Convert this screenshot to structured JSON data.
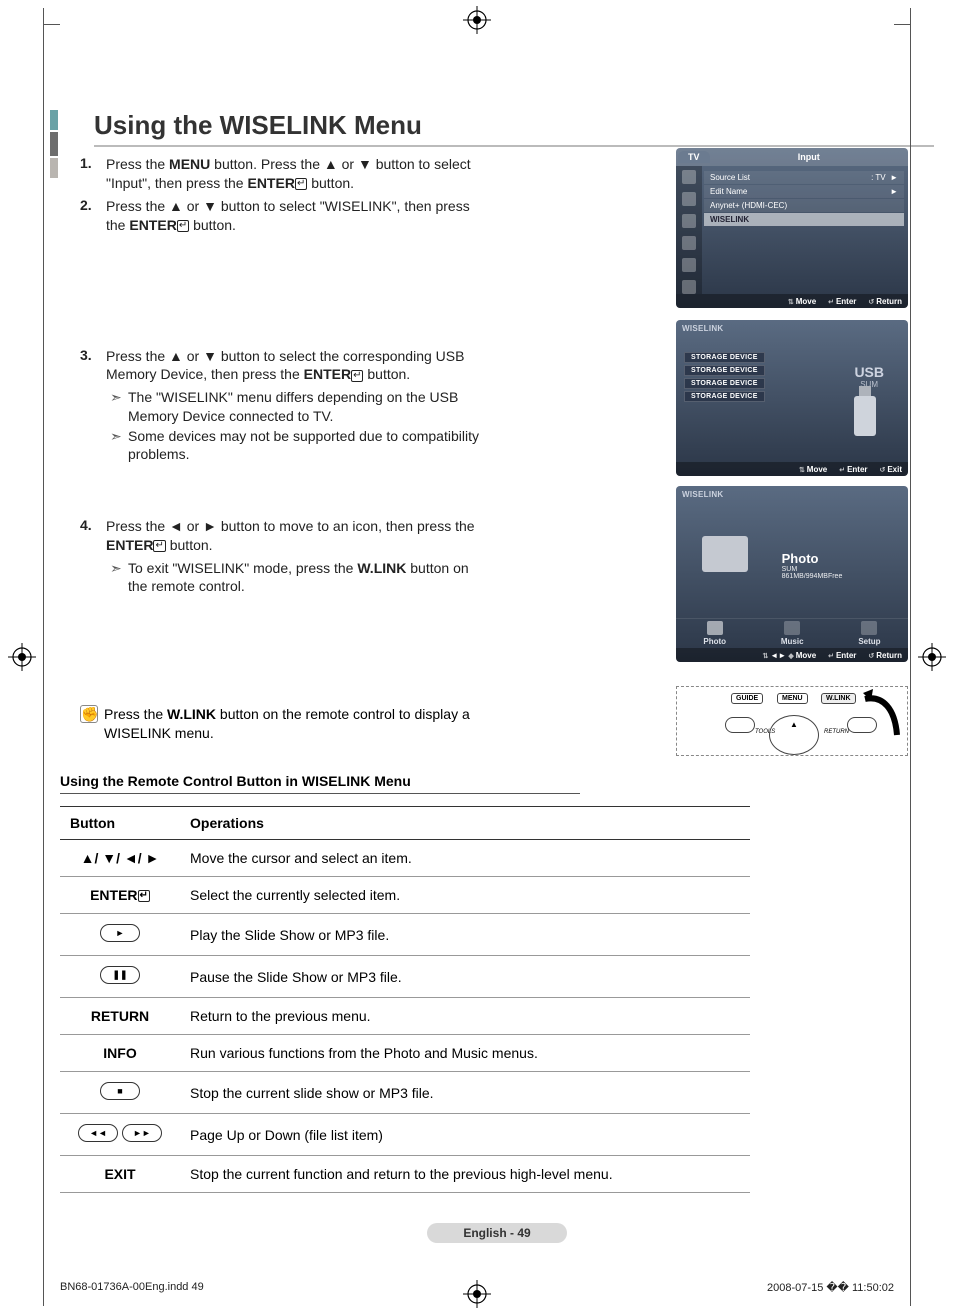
{
  "title": "Using the WISELINK Menu",
  "steps": {
    "s1": {
      "num": "1.",
      "text_a": "Press the ",
      "menu": "MENU",
      "text_b": " button. Press the ▲ or ▼ button to select \"Input\", then press the ",
      "enter": "ENTER",
      "text_c": " button."
    },
    "s2": {
      "num": "2.",
      "text_a": "Press the ▲ or ▼ button to select \"WISELINK\", then press the ",
      "enter": "ENTER",
      "text_b": " button."
    },
    "s3": {
      "num": "3.",
      "text_a": "Press the ▲ or ▼ button to select the corresponding USB Memory Device, then press the ",
      "enter": "ENTER",
      "text_b": " button."
    },
    "s3b1": "The \"WISELINK\" menu differs depending on the USB Memory Device connected to TV.",
    "s3b2": "Some devices may not be supported due to compatibility problems.",
    "s4": {
      "num": "4.",
      "text_a": "Press the ◄ or ► button to move to an icon, then press the ",
      "enter": "ENTER",
      "text_b": " button."
    },
    "s4b1_a": "To exit \"WISELINK\" mode, press the ",
    "s4b1_bold": "W.LINK",
    "s4b1_b": " button on the remote control."
  },
  "note": {
    "text_a": "Press the ",
    "bold": "W.LINK",
    "text_b": " button on the remote control to display a WISELINK menu."
  },
  "sub_heading": "Using the Remote Control Button in WISELINK Menu",
  "table": {
    "head_button": "Button",
    "head_ops": "Operations",
    "rows": [
      {
        "btn": "▲/ ▼/ ◄/ ►",
        "op": "Move the cursor and select an item."
      },
      {
        "btn": "ENTER",
        "op": "Select the currently selected item."
      },
      {
        "btn": "PLAY_ICON",
        "op": "Play the Slide Show or MP3 file."
      },
      {
        "btn": "PAUSE_ICON",
        "op": "Pause the Slide Show or MP3 file."
      },
      {
        "btn": "RETURN",
        "op": "Return to the previous menu."
      },
      {
        "btn": "INFO",
        "op": "Run various functions from the Photo and Music menus."
      },
      {
        "btn": "STOP_ICON",
        "op": "Stop the current slide show or MP3 file."
      },
      {
        "btn": "REW_FF_ICON",
        "op": "Page Up or Down (file list item)"
      },
      {
        "btn": "EXIT",
        "op": "Stop the current function and return to the previous high-level menu."
      }
    ]
  },
  "osd1": {
    "tab": "TV",
    "title": "Input",
    "rows": {
      "source": "Source List",
      "source_val": ": TV",
      "edit": "Edit Name",
      "anynet": "Anynet+ (HDMI-CEC)",
      "wiselink": "WISELINK"
    },
    "footer": {
      "move": "Move",
      "enter": "Enter",
      "ret": "Return"
    }
  },
  "osd2": {
    "brand": "WISELINK",
    "storage": [
      "STORAGE DEVICE",
      "STORAGE DEVICE",
      "STORAGE DEVICE",
      "STORAGE DEVICE"
    ],
    "usb": "USB",
    "usb_sub": "SUM",
    "footer": {
      "move": "Move",
      "enter": "Enter",
      "ret": "Exit"
    }
  },
  "osd3": {
    "brand": "WISELINK",
    "photo": "Photo",
    "photo_sub1": "SUM",
    "photo_sub2": "861MB/994MBFree",
    "tabs": {
      "photo": "Photo",
      "music": "Music",
      "setup": "Setup"
    },
    "footer": {
      "move": "Move",
      "enter": "Enter",
      "ret": "Return"
    }
  },
  "remote": {
    "guide": "GUIDE",
    "menu": "MENU",
    "wlink": "W.LINK",
    "tools": "TOOLS",
    "return": "RETURN"
  },
  "page_label": "English - 49",
  "footer_left": "BN68-01736A-00Eng.indd   49",
  "footer_right": "2008-07-15   �� 11:50:02"
}
